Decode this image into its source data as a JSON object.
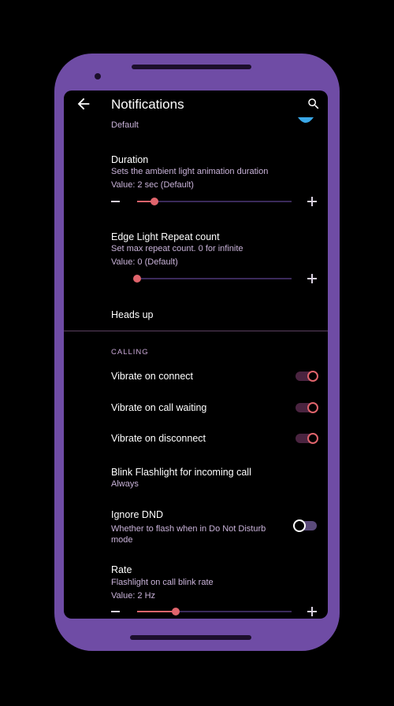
{
  "colors": {
    "frame": "#6f4ca5",
    "accent": "#e0646c",
    "summary_text": "#c8b2d8",
    "section_header": "#c9a8d6"
  },
  "toolbar": {
    "title": "Notifications",
    "back_icon": "arrow-back-icon",
    "search_icon": "search-icon"
  },
  "top_partial": {
    "summary": "Default"
  },
  "duration": {
    "title": "Duration",
    "summary": "Sets the ambient light animation duration",
    "value": "Value: 2 sec (Default)",
    "slider_fraction": 0.11
  },
  "edge_light": {
    "title": "Edge Light Repeat count",
    "summary": "Set max repeat count. 0 for infinite",
    "value": "Value: 0 (Default)",
    "slider_fraction": 0.0
  },
  "heads_up": {
    "title": "Heads up"
  },
  "calling": {
    "header": "CALLING",
    "vibrate_connect": {
      "title": "Vibrate on connect",
      "enabled": true
    },
    "vibrate_waiting": {
      "title": "Vibrate on call waiting",
      "enabled": true
    },
    "vibrate_disconnect": {
      "title": "Vibrate on disconnect",
      "enabled": true
    },
    "blink": {
      "title": "Blink Flashlight for incoming call",
      "summary": "Always"
    },
    "ignore_dnd": {
      "title": "Ignore DND",
      "summary_line1": "Whether to flash when in Do Not Disturb",
      "summary_line2": "mode",
      "enabled": false
    },
    "rate": {
      "title": "Rate",
      "summary": "Flashlight on call blink rate",
      "value": "Value: 2 Hz",
      "slider_fraction": 0.25
    }
  }
}
